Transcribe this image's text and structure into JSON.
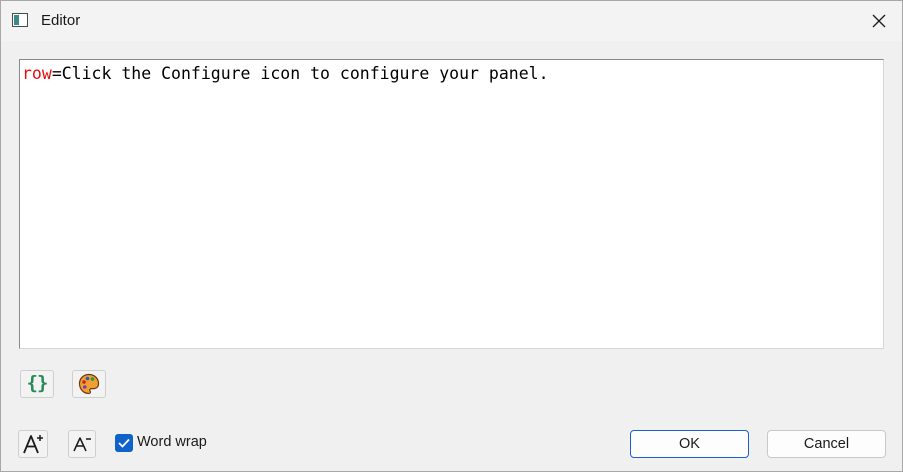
{
  "window": {
    "title": "Editor"
  },
  "editor": {
    "keyword": "row",
    "text": "=Click the Configure icon to configure your panel."
  },
  "toolbar": {
    "braces_glyph": "{}"
  },
  "footer": {
    "word_wrap_label": "Word wrap",
    "word_wrap_checked": true,
    "ok_label": "OK",
    "cancel_label": "Cancel"
  },
  "colors": {
    "keyword": "#e0110f",
    "accent": "#0f62c9",
    "braces": "#2a8a5a"
  },
  "icons": {
    "app": "app-window-icon",
    "close": "close-icon",
    "format": "braces-icon",
    "palette": "palette-icon",
    "font_increase": "font-increase-icon",
    "font_decrease": "font-decrease-icon",
    "check": "checkmark-icon"
  }
}
